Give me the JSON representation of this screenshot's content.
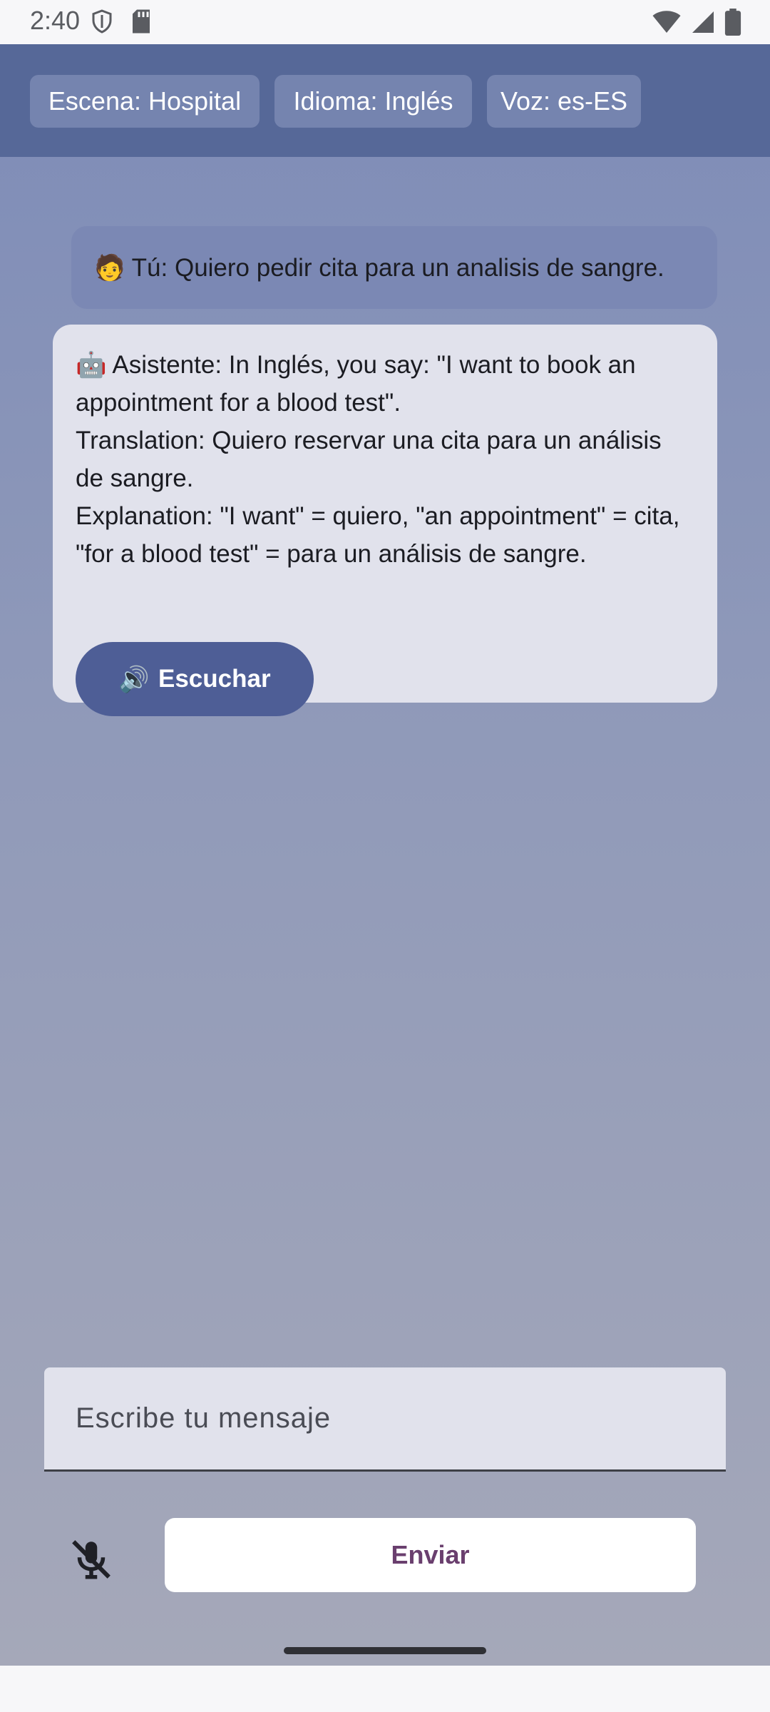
{
  "status_bar": {
    "time": "2:40",
    "left_icons": [
      "shield-icon",
      "sd-card-icon"
    ],
    "right_icons": [
      "wifi-icon",
      "cell-signal-icon",
      "battery-icon"
    ]
  },
  "header": {
    "chips": [
      {
        "label": "Escena: Hospital"
      },
      {
        "label": "Idioma: Inglés"
      },
      {
        "label": "Voz: es-ES"
      }
    ]
  },
  "conversation": {
    "user_message": "🧑 Tú: Quiero pedir cita para un analisis de sangre.",
    "assistant_message": "🤖 Asistente: In Inglés, you say: \"I want to book an appointment for a blood test\".\nTranslation: Quiero reservar una cita para un análisis de sangre.\nExplanation: \"I want\" = quiero, \"an appointment\" = cita, \"for a blood test\" = para un análisis de sangre.",
    "listen_button": {
      "icon": "🔊",
      "label": "Escuchar"
    }
  },
  "composer": {
    "input_placeholder": "Escribe tu mensaje",
    "input_value": "",
    "mic_icon": "mic-off-icon",
    "send_label": "Enviar"
  },
  "colors": {
    "header_bg": "#566898",
    "chip_bg": "#7584af",
    "user_bubble": "#7b88b4",
    "assistant_bubble": "#e1e2ec",
    "primary_button": "#4e5e96",
    "send_text": "#6a3f6e"
  }
}
